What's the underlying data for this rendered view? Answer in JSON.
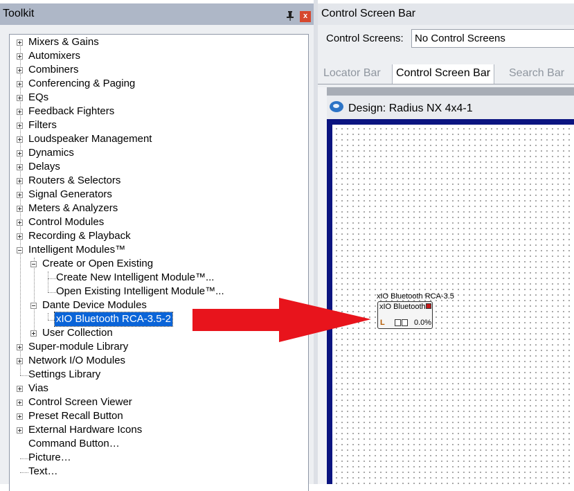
{
  "toolkit": {
    "title": "Toolkit",
    "close_label": "x",
    "items": {
      "mixers": "Mixers & Gains",
      "automixers": "Automixers",
      "combiners": "Combiners",
      "conferencing": "Conferencing & Paging",
      "eqs": "EQs",
      "feedback": "Feedback Fighters",
      "filters": "Filters",
      "loudspeaker": "Loudspeaker Management",
      "dynamics": "Dynamics",
      "delays": "Delays",
      "routers": "Routers & Selectors",
      "signal_generators": "Signal Generators",
      "meters": "Meters & Analyzers",
      "control_modules": "Control Modules",
      "recording": "Recording & Playback",
      "intelligent": "Intelligent Modules™",
      "create_or_open": "Create or Open Existing",
      "create_new": "Create New Intelligent Module™...",
      "open_existing": "Open Existing Intelligent Module™...",
      "dante": "Dante Device Modules",
      "xio": "xIO Bluetooth RCA-3.5-2",
      "user_collection": "User Collection",
      "super_module": "Super-module Library",
      "network_io": "Network I/O Modules",
      "settings_library": "Settings Library",
      "vias": "Vias",
      "control_screen_viewer": "Control Screen Viewer",
      "preset_recall": "Preset Recall Button",
      "external_hardware": "External Hardware Icons",
      "command_button": "Command Button…",
      "picture": "Picture…",
      "text": "Text…"
    }
  },
  "control_screen_bar": {
    "title": "Control Screen Bar",
    "label": "Control Screens:",
    "dropdown_value": "No Control Screens",
    "tabs": {
      "locator": "Locator Bar",
      "control": "Control Screen Bar",
      "search": "Search Bar"
    }
  },
  "design": {
    "title": "Design: Radius NX 4x4-1",
    "module": {
      "caption": "xIO Bluetooth RCA-3.5",
      "name": "xIO Bluetooth",
      "channel": "L",
      "percent": "0.0%"
    }
  },
  "colors": {
    "selection": "#0a64d8",
    "canvas_border": "#0b1480",
    "arrow": "#e8141c"
  }
}
